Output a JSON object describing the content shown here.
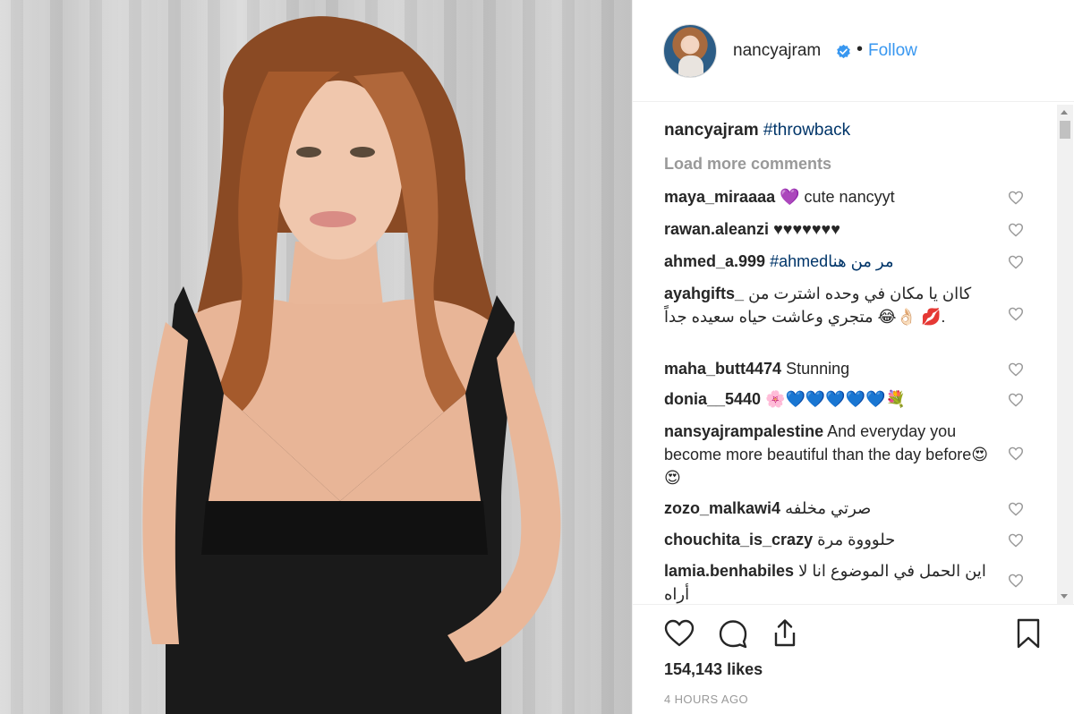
{
  "header": {
    "username": "nancyajram",
    "separator": "•",
    "follow_label": "Follow"
  },
  "caption": {
    "username": "nancyajram",
    "text": "#throwback"
  },
  "load_more_label": "Load more comments",
  "comments": [
    {
      "user": "maya_miraaaa",
      "text": "💜 cute nancyyt"
    },
    {
      "user": "rawan.aleanzi",
      "text": "♥♥♥♥♥♥♥"
    },
    {
      "user": "ahmed_a.999",
      "text": "#ahmedمر من هنا"
    },
    {
      "user": "ayahgifts_",
      "text": "كاان يا مكان في وحده اشترت من متجري وعاشت حياه سعيده جداً 😂👌🏻 💋."
    },
    {
      "user": "maha_butt4474",
      "text": "Stunning"
    },
    {
      "user": "donia__5440",
      "text": "🌸💙💙💙💙💙💐"
    },
    {
      "user": "nansyajrampalestine",
      "text": "And everyday you become more beautiful than the day before😍😍"
    },
    {
      "user": "zozo_malkawi4",
      "text": "صرتي مخلفه"
    },
    {
      "user": "chouchita_is_crazy",
      "text": "حلوووة مرة"
    },
    {
      "user": "lamia.benhabiles",
      "text": "اين الحمل في الموضوع انا لا أراه"
    }
  ],
  "likes": "154,143 likes",
  "timestamp": "4 HOURS AGO",
  "colors": {
    "link": "#3897f0",
    "hashtag": "#003569",
    "muted": "#999999",
    "text": "#262626"
  },
  "icons": [
    "verified-badge-icon",
    "heart-icon",
    "comment-icon",
    "share-icon",
    "bookmark-icon"
  ]
}
